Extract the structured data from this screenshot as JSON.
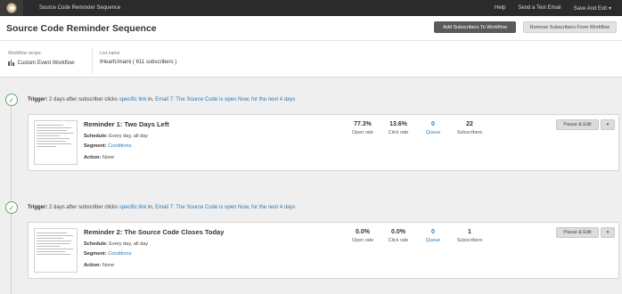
{
  "topbar": {
    "title": "Source Code Reminder Sequence",
    "help": "Help",
    "send_test": "Send a Test Email",
    "save_exit": "Save And Exit",
    "chevron": "▾"
  },
  "header": {
    "title": "Source Code Reminder Sequence",
    "add_subscribers": "Add Subscribers To Workflow",
    "remove_subscribers": "Remove Subscribers From Workflow"
  },
  "meta": {
    "recipe_label": "Workflow recipe",
    "recipe_value": "Custom Event Workflow",
    "list_label": "List name",
    "list_value": "IHeartUmami ( 611 subscribers )"
  },
  "checkmark": "✓",
  "emails": [
    {
      "trigger_label": "Trigger:",
      "trigger_text": " 2 days after subscriber clicks ",
      "trigger_link1": "specific link",
      "trigger_mid": " in, ",
      "trigger_link2": "Email 7: The Source Code is open Now, for the next 4 days",
      "title": "Reminder 1: Two Days Left",
      "schedule_label": "Schedule:",
      "schedule_value": " Every day, all day",
      "segment_label": "Segment:",
      "segment_value": "Conditions",
      "action_label": "Action:",
      "action_value": " None",
      "stats": [
        {
          "value": "77.3%",
          "label": "Open rate"
        },
        {
          "value": "13.6%",
          "label": "Click rate"
        },
        {
          "value": "0",
          "label": "Queue"
        },
        {
          "value": "22",
          "label": "Subscribers"
        }
      ],
      "pause_label": "Pause & Edit",
      "dropdown": "▾"
    },
    {
      "trigger_label": "Trigger:",
      "trigger_text": " 2 days after subscriber clicks ",
      "trigger_link1": "specific link",
      "trigger_mid": " in, ",
      "trigger_link2": "Email 7: The Source Code is open Now, for the next 4 days",
      "title": "Reminder 2: The Source Code Closes Today",
      "schedule_label": "Schedule:",
      "schedule_value": " Every day, all day",
      "segment_label": "Segment:",
      "segment_value": "Conditions",
      "action_label": "Action:",
      "action_value": " None",
      "stats": [
        {
          "value": "0.0%",
          "label": "Open rate"
        },
        {
          "value": "0.0%",
          "label": "Click rate"
        },
        {
          "value": "0",
          "label": "Queue"
        },
        {
          "value": "1",
          "label": "Subscribers"
        }
      ],
      "pause_label": "Pause & Edit",
      "dropdown": "▾"
    }
  ]
}
